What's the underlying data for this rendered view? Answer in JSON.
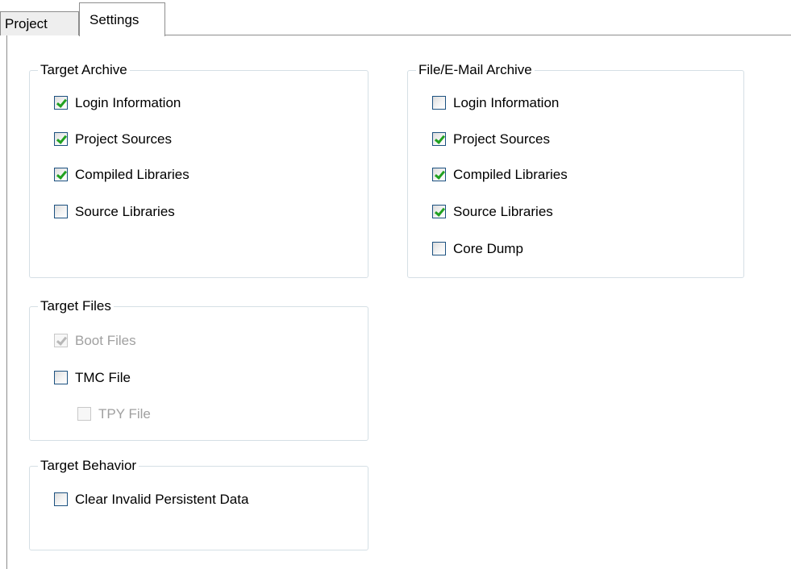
{
  "tabs": [
    {
      "label": "Project",
      "active": false
    },
    {
      "label": "Settings",
      "active": true
    }
  ],
  "groups": {
    "target_archive": {
      "title": "Target Archive",
      "items": [
        {
          "label": "Login Information",
          "checked": true,
          "enabled": true
        },
        {
          "label": "Project Sources",
          "checked": true,
          "enabled": true
        },
        {
          "label": "Compiled Libraries",
          "checked": true,
          "enabled": true
        },
        {
          "label": "Source Libraries",
          "checked": false,
          "enabled": true
        }
      ]
    },
    "file_email_archive": {
      "title": "File/E-Mail Archive",
      "items": [
        {
          "label": "Login Information",
          "checked": false,
          "enabled": true
        },
        {
          "label": "Project Sources",
          "checked": true,
          "enabled": true
        },
        {
          "label": "Compiled Libraries",
          "checked": true,
          "enabled": true
        },
        {
          "label": "Source Libraries",
          "checked": true,
          "enabled": true
        },
        {
          "label": "Core Dump",
          "checked": false,
          "enabled": true
        }
      ]
    },
    "target_files": {
      "title": "Target Files",
      "items": [
        {
          "label": "Boot Files",
          "checked": true,
          "enabled": false
        },
        {
          "label": "TMC File",
          "checked": false,
          "enabled": true
        },
        {
          "label": "TPY File",
          "checked": false,
          "enabled": false
        }
      ]
    },
    "target_behavior": {
      "title": "Target Behavior",
      "items": [
        {
          "label": "Clear Invalid Persistent Data",
          "checked": false,
          "enabled": true
        }
      ]
    }
  },
  "colors": {
    "tab_border": "#8d8d8d",
    "group_border": "#d5dfe5",
    "checkbox_border": "#1c5180",
    "check_mark": "#21a121",
    "disabled_text": "#a0a0a0"
  }
}
